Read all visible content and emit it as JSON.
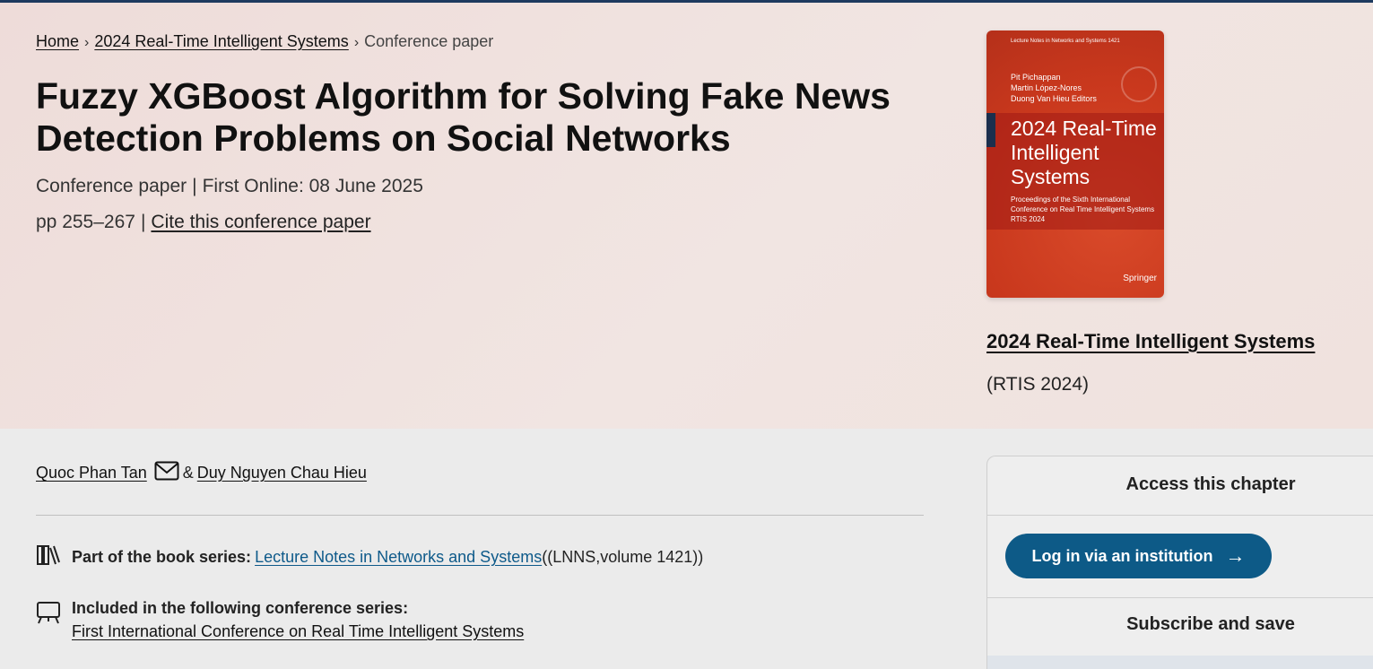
{
  "breadcrumb": {
    "home": "Home",
    "book": "2024 Real-Time Intelligent Systems",
    "current": "Conference paper"
  },
  "title": "Fuzzy XGBoost Algorithm for Solving Fake News Detection Problems on Social Networks",
  "meta": {
    "type": "Conference paper",
    "first_online": "First Online: 08 June 2025",
    "pages": "pp 255–267",
    "cite_label": "Cite this conference paper"
  },
  "cover": {
    "series": "Lecture Notes in Networks and Systems 1421",
    "editor1": "Pit Pichappan",
    "editor2": "Martin López-Nores",
    "editor3": "Duong Van Hieu  Editors",
    "title_line1": "2024 Real-Time",
    "title_line2": "Intelligent",
    "title_line3": "Systems",
    "subtitle": "Proceedings of the Sixth International Conference on Real Time Intelligent Systems RTIS 2024",
    "publisher": "Springer"
  },
  "book": {
    "title": "2024 Real-Time Intelligent Systems",
    "short": "(RTIS 2024)"
  },
  "authors": {
    "author1": "Quoc Phan Tan",
    "amp": "&",
    "author2": "Duy Nguyen Chau Hieu"
  },
  "series": {
    "label": "Part of the book series:",
    "link": "Lecture Notes in Networks and Systems",
    "suffix": "((LNNS,volume 1421))"
  },
  "conference": {
    "label": "Included in the following conference series:",
    "link": "First International Conference on Real Time Intelligent Systems"
  },
  "access": {
    "title": "Access this chapter",
    "login": "Log in via an institution",
    "subscribe": "Subscribe and save",
    "accent": "#0d5a87"
  },
  "icons": {
    "mail": "mail-icon",
    "books": "books-icon",
    "presentation": "presentation-icon",
    "arrow": "arrow-right-icon"
  }
}
